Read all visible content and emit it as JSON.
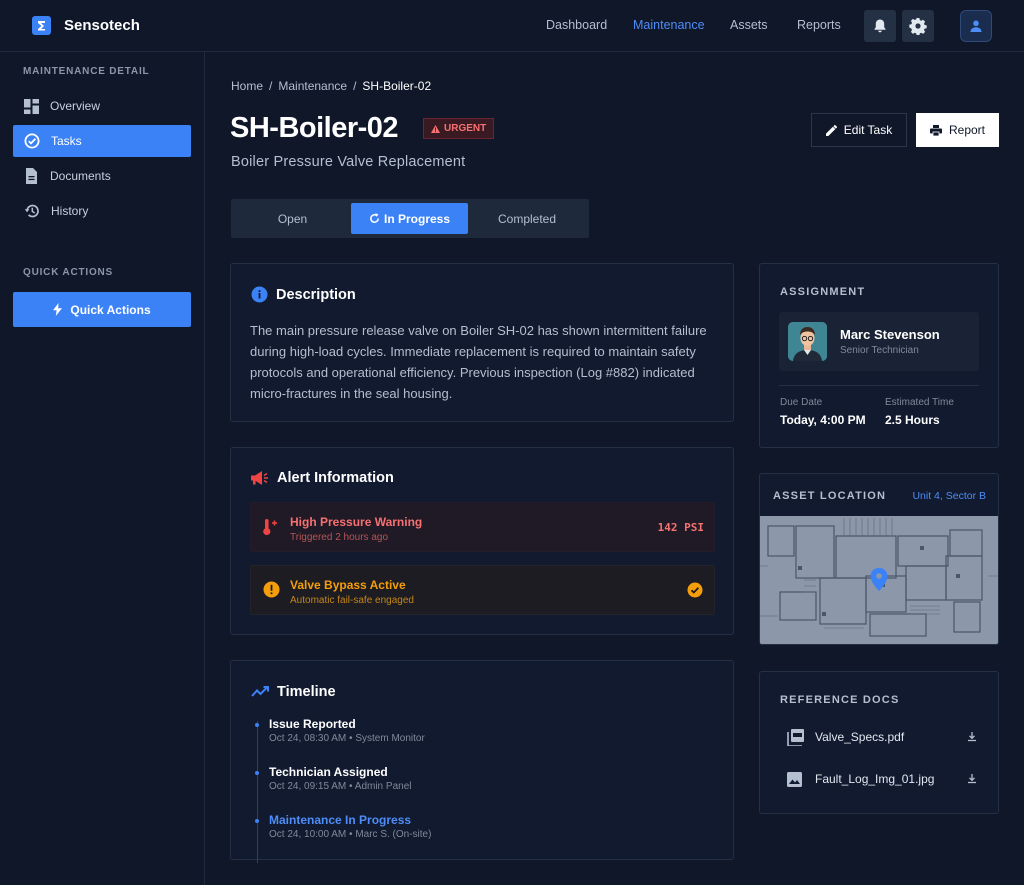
{
  "app": {
    "brand": "Sensotech"
  },
  "topnav": [
    {
      "label": "Dashboard",
      "active": false
    },
    {
      "label": "Maintenance",
      "active": true
    },
    {
      "label": "Assets",
      "active": false
    },
    {
      "label": "Reports",
      "active": false
    }
  ],
  "sidebar": {
    "heading": "MAINTENANCE DETAIL",
    "items": [
      {
        "label": "Overview",
        "icon": "dashboard-icon",
        "active": false
      },
      {
        "label": "Tasks",
        "icon": "check-circle-icon",
        "active": true
      },
      {
        "label": "Documents",
        "icon": "document-icon",
        "active": false
      },
      {
        "label": "History",
        "icon": "history-icon",
        "active": false
      }
    ],
    "quick_heading": "QUICK ACTIONS",
    "quick_button": "Quick Actions"
  },
  "breadcrumb": [
    "Home",
    "Maintenance",
    "SH-Boiler-02"
  ],
  "task": {
    "title": "SH-Boiler-02",
    "badge": "URGENT",
    "subtitle": "Boiler Pressure Valve Replacement"
  },
  "actions": {
    "edit": "Edit Task",
    "report": "Report"
  },
  "status_tabs": [
    {
      "label": "Open",
      "active": false
    },
    {
      "label": "In Progress",
      "active": true
    },
    {
      "label": "Completed",
      "active": false
    }
  ],
  "description": {
    "title": "Description",
    "text": "The main pressure release valve on Boiler SH-02 has shown intermittent failure during high-load cycles. Immediate replacement is required to maintain safety protocols and operational efficiency. Previous inspection (Log #882) indicated micro-fractures in the seal housing."
  },
  "alerts": {
    "title": "Alert Information",
    "items": [
      {
        "title": "High Pressure Warning",
        "sub": "Triggered 2 hours ago",
        "value": "142 PSI",
        "level": "danger"
      },
      {
        "title": "Valve Bypass Active",
        "sub": "Automatic fail-safe engaged",
        "level": "warning"
      }
    ]
  },
  "timeline": {
    "title": "Timeline",
    "items": [
      {
        "title": "Issue Reported",
        "meta": "Oct 24, 08:30 AM • System Monitor",
        "active": false
      },
      {
        "title": "Technician Assigned",
        "meta": "Oct 24, 09:15 AM • Admin Panel",
        "active": false
      },
      {
        "title": "Maintenance In Progress",
        "meta": "Oct 24, 10:00 AM • Marc S. (On-site)",
        "active": true
      }
    ]
  },
  "assignment": {
    "heading": "ASSIGNMENT",
    "name": "Marc Stevenson",
    "role": "Senior Technician",
    "due_label": "Due Date",
    "due_value": "Today, 4:00 PM",
    "est_label": "Estimated Time",
    "est_value": "2.5 Hours"
  },
  "location": {
    "heading": "ASSET LOCATION",
    "link": "Unit 4, Sector B"
  },
  "docs": {
    "heading": "REFERENCE DOCS",
    "items": [
      {
        "name": "Valve_Specs.pdf",
        "icon": "pdf-icon"
      },
      {
        "name": "Fault_Log_Img_01.jpg",
        "icon": "image-icon"
      }
    ]
  },
  "colors": {
    "accent": "#3b82f6",
    "danger": "#f87171",
    "warning": "#f59e0b",
    "background": "#0f1729"
  }
}
